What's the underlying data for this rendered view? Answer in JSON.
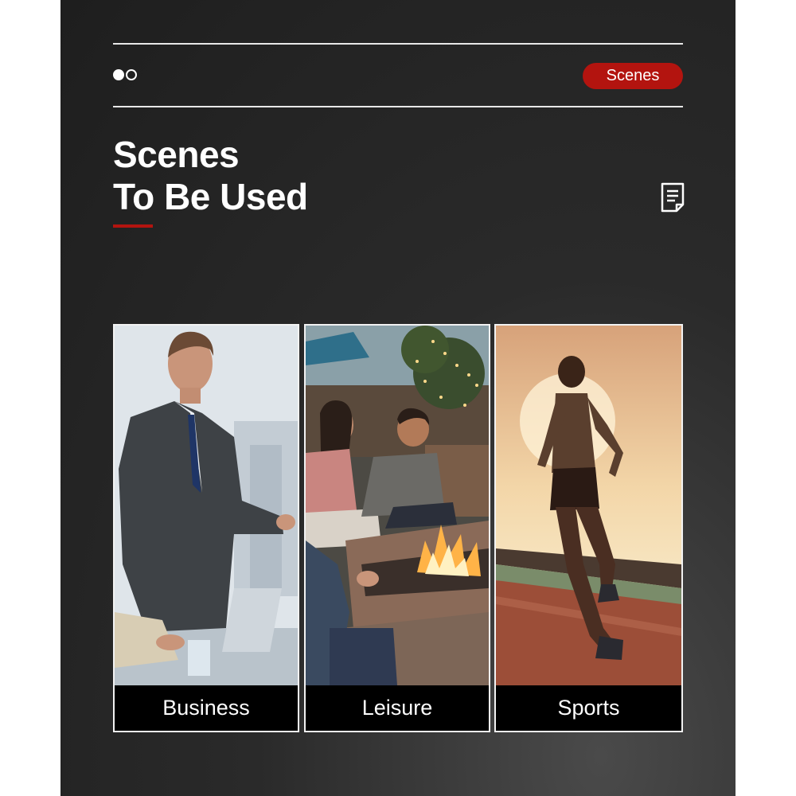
{
  "header": {
    "badge_label": "Scenes",
    "indicator_icon": "toggle-dots-icon"
  },
  "title": {
    "line1": "Scenes",
    "line2": "To Be Used",
    "accent_color": "#b3140f"
  },
  "document_icon": "document-icon",
  "cards": [
    {
      "label": "Business",
      "image": "businessman-in-suit-at-meeting"
    },
    {
      "label": "Leisure",
      "image": "friends-at-outdoor-fire-pit"
    },
    {
      "label": "Sports",
      "image": "woman-running-at-sunset"
    }
  ],
  "colors": {
    "background": "#232323",
    "badge": "#b3140f",
    "text": "#ffffff"
  }
}
